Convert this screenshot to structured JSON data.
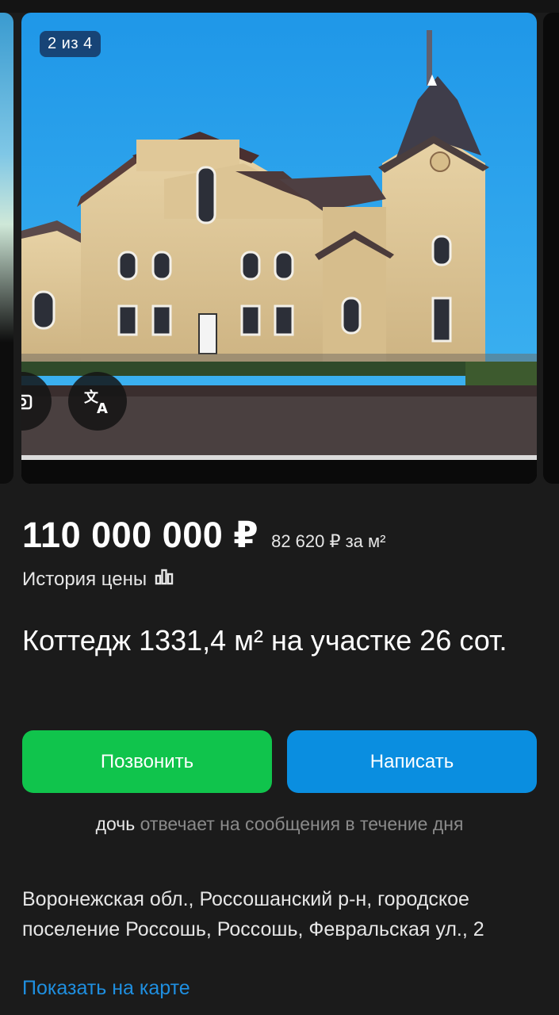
{
  "gallery": {
    "counter": "2 из 4",
    "icons": [
      "camera-search-icon",
      "translate-icon"
    ]
  },
  "listing": {
    "price": "110 000 000 ₽",
    "price_per_m2": "82 620 ₽ за м²",
    "price_history_label": "История цены",
    "title": "Коттедж 1331,4 м² на участке 26 сот."
  },
  "actions": {
    "call_label": "Позвонить",
    "write_label": "Написать"
  },
  "seller": {
    "name": "дочь",
    "reply_text": "отвечает на сообщения в течение дня"
  },
  "location": {
    "address": "Воронежская обл., Россошанский р-н, городское поселение Россошь, Россошь, Февральская ул., 2",
    "map_link": "Показать на карте"
  },
  "colors": {
    "background": "#1b1b1b",
    "call_button": "#10c44c",
    "write_button": "#0a8ee0",
    "link": "#1f8fe0"
  }
}
